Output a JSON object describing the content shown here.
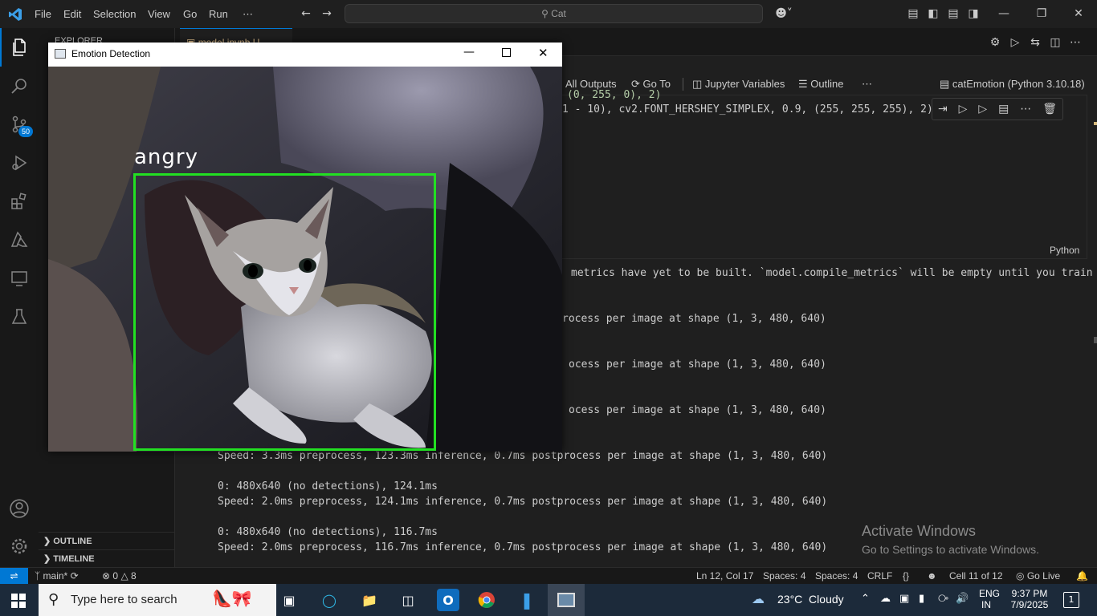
{
  "titlebar": {
    "menus": [
      "File",
      "Edit",
      "Selection",
      "View",
      "Go",
      "Run",
      "⋯"
    ],
    "search_text": "Cat"
  },
  "activity": {
    "scm_badge": "50"
  },
  "sidebar": {
    "explorer_title": "EXPLORER",
    "outline": "OUTLINE",
    "timeline": "TIMELINE"
  },
  "tabs": {
    "active": "model.ipynb U"
  },
  "notebook_toolbar": {
    "all_outputs": "All Outputs",
    "go_to": "Go To",
    "jupyter_variables": "Jupyter Variables",
    "outline": "Outline",
    "more": "⋯",
    "kernel": "catEmotion (Python 3.10.18)"
  },
  "code": {
    "line1": "(0, 255, 0), 2)",
    "line2": "1 - 10), cv2.FONT_HERSHEY_SIMPLEX, 0.9, (255, 255, 255), 2)",
    "language": "Python"
  },
  "output": {
    "lines": [
      "metrics have yet to be built. `model.compile_metrics` will be empty until you train",
      "",
      "rocess per image at shape (1, 3, 480, 640)",
      "",
      "ocess per image at shape (1, 3, 480, 640)",
      "",
      "ocess per image at shape (1, 3, 480, 640)",
      "",
      "Speed: 3.3ms preprocess, 123.3ms inference, 0.7ms postprocess per image at shape (1, 3, 480, 640)",
      "",
      "0: 480x640 (no detections), 124.1ms",
      "Speed: 2.0ms preprocess, 124.1ms inference, 0.7ms postprocess per image at shape (1, 3, 480, 640)",
      "",
      "0: 480x640 (no detections), 116.7ms",
      "Speed: 2.0ms preprocess, 116.7ms inference, 0.7ms postprocess per image at shape (1, 3, 480, 640)"
    ]
  },
  "watermark": {
    "title": "Activate Windows",
    "subtitle": "Go to Settings to activate Windows."
  },
  "popup": {
    "title": "Emotion Detection",
    "label": "angry",
    "box_color": "#22e022"
  },
  "statusbar": {
    "branch": "main*",
    "problems": "0",
    "warnings": "8",
    "position": "Ln 12, Col 17",
    "spaces1": "Spaces: 4",
    "spaces2": "Spaces: 4",
    "eol": "CRLF",
    "braces": "{}",
    "cell": "Cell 11 of 12",
    "golive": "Go Live"
  },
  "taskbar": {
    "search_placeholder": "Type here to search",
    "weather": "23°C  Cloudy",
    "lang1": "ENG",
    "lang2": "IN",
    "time": "9:37 PM",
    "date": "7/9/2025",
    "notifications": "1"
  }
}
